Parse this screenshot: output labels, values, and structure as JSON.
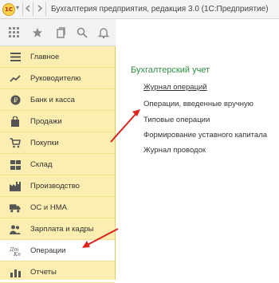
{
  "window": {
    "title": "Бухгалтерия предприятия, редакция 3.0  (1С:Предприятие)",
    "logo": "1С"
  },
  "toolbar": {
    "icons": [
      "apps-grid-icon",
      "star-icon",
      "history-icon",
      "search-icon",
      "bell-icon"
    ]
  },
  "sidebar": {
    "items": [
      {
        "label": "Главное",
        "icon": "menu-icon"
      },
      {
        "label": "Руководителю",
        "icon": "trend-icon"
      },
      {
        "label": "Банк и касса",
        "icon": "coin-icon"
      },
      {
        "label": "Продажи",
        "icon": "bag-icon"
      },
      {
        "label": "Покупки",
        "icon": "cart-icon"
      },
      {
        "label": "Склад",
        "icon": "warehouse-icon"
      },
      {
        "label": "Производство",
        "icon": "factory-icon"
      },
      {
        "label": "ОС и НМА",
        "icon": "truck-icon"
      },
      {
        "label": "Зарплата и кадры",
        "icon": "people-icon"
      },
      {
        "label": "Операции",
        "icon": "operations-icon",
        "active": true
      },
      {
        "label": "Отчеты",
        "icon": "report-icon"
      }
    ]
  },
  "main": {
    "section_title": "Бухгалтерский учет",
    "links": [
      "Журнал операций",
      "Операции, введенные вручную",
      "Типовые операции",
      "Формирование уставного капитала",
      "Журнал проводок"
    ]
  },
  "colors": {
    "sidebar_bg": "#fbeeb0",
    "section_title": "#2f8f3f",
    "arrow": "#d9231c"
  }
}
